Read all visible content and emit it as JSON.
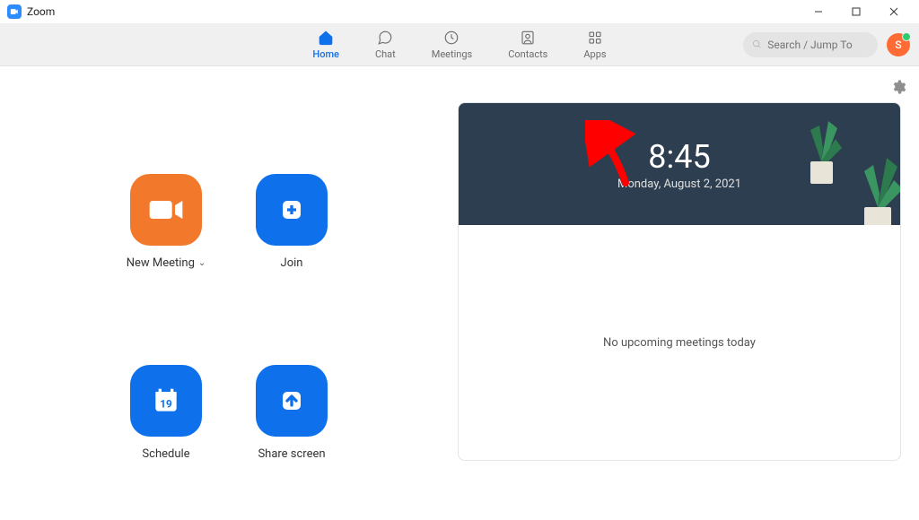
{
  "window": {
    "title": "Zoom"
  },
  "nav": {
    "tabs": [
      {
        "label": "Home",
        "active": true
      },
      {
        "label": "Chat",
        "active": false
      },
      {
        "label": "Meetings",
        "active": false
      },
      {
        "label": "Contacts",
        "active": false
      },
      {
        "label": "Apps",
        "active": false
      }
    ]
  },
  "search": {
    "placeholder": "Search / Jump To"
  },
  "avatar": {
    "initial": "S"
  },
  "actions": {
    "new_meeting": "New Meeting",
    "join": "Join",
    "schedule": "Schedule",
    "share": "Share screen"
  },
  "calendar": {
    "day": "19"
  },
  "clock": {
    "time": "8:45",
    "date": "Monday, August 2, 2021"
  },
  "meetings": {
    "empty_text": "No upcoming meetings today"
  }
}
